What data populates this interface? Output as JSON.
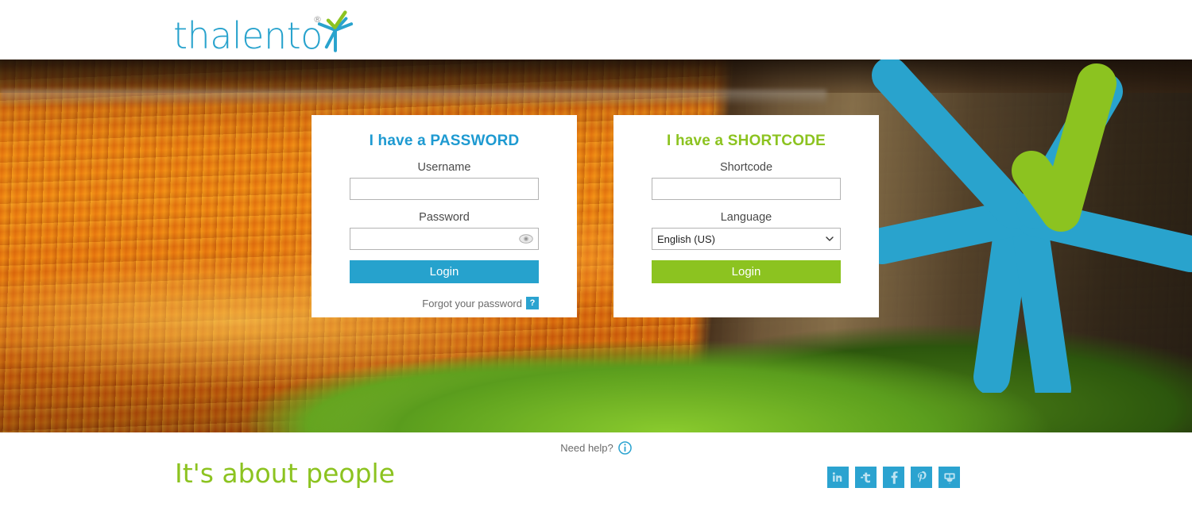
{
  "header": {
    "logo_text": "thalento",
    "logo_registered": "®",
    "logo_star_icon": "thalento-star-icon"
  },
  "password_panel": {
    "title": "I have a PASSWORD",
    "title_color": "#1e9ad1",
    "username_label": "Username",
    "username_value": "",
    "username_placeholder": "",
    "password_label": "Password",
    "password_value": "",
    "password_placeholder": "",
    "show_password_icon": "eye-icon",
    "login_label": "Login",
    "login_color": "#26a2cd",
    "forgot_label": "Forgot your password",
    "forgot_help_icon": "question-mark-icon",
    "forgot_help_label": "?"
  },
  "shortcode_panel": {
    "title": "I have a SHORTCODE",
    "title_color": "#8cc320",
    "shortcode_label": "Shortcode",
    "shortcode_value": "",
    "shortcode_placeholder": "",
    "language_label": "Language",
    "language_selected": "English (US)",
    "language_options": [
      "English (US)"
    ],
    "language_caret_icon": "chevron-down-icon",
    "login_label": "Login",
    "login_color": "#8cc320"
  },
  "footer": {
    "need_help_label": "Need help?",
    "need_help_icon": "info-icon",
    "tagline": "It's about people",
    "tagline_color": "#8cc320",
    "social": [
      {
        "name": "linkedin",
        "icon": "linkedin-icon",
        "glyph": "in"
      },
      {
        "name": "twitter",
        "icon": "twitter-icon",
        "glyph": "t"
      },
      {
        "name": "facebook",
        "icon": "facebook-icon",
        "glyph": "f"
      },
      {
        "name": "pinterest",
        "icon": "pinterest-icon",
        "glyph": "P"
      },
      {
        "name": "slideshare",
        "icon": "slideshare-icon",
        "glyph": ""
      }
    ],
    "social_color": "#2ba3d0"
  },
  "hero": {
    "background_description": "autumn forest floor with orange leaves, mossy tree trunk",
    "star_icon": "thalento-star-icon",
    "star_blue": "#29a3cd",
    "star_green": "#8cc320"
  }
}
